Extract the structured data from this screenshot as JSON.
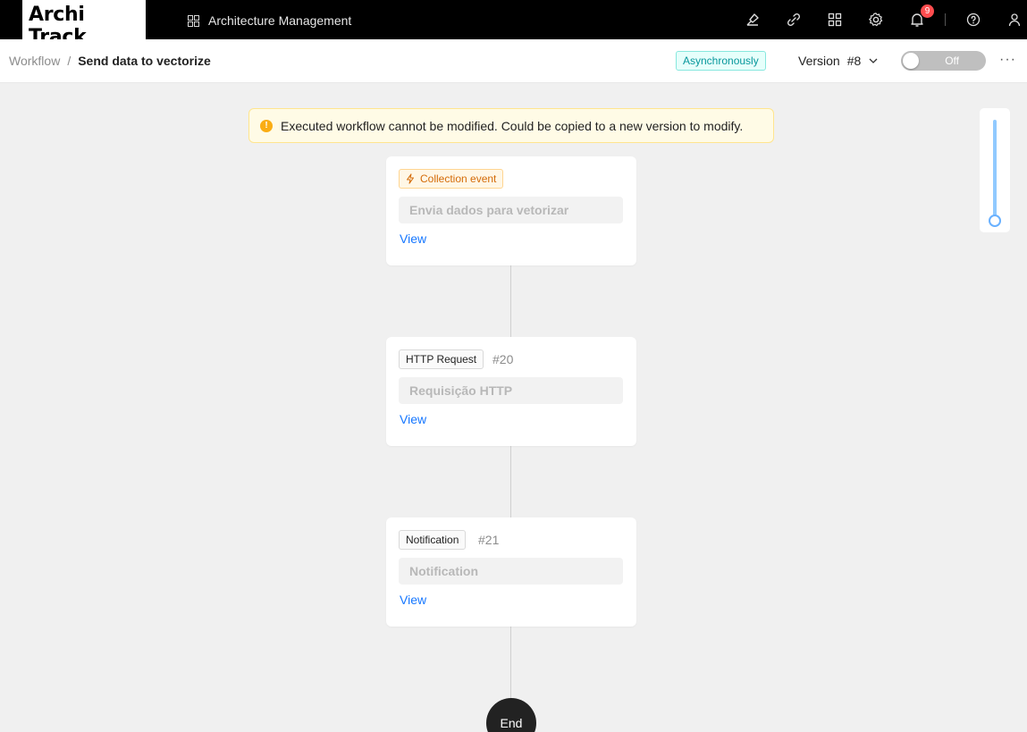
{
  "brand": {
    "logo_text": "Archi Track"
  },
  "topbar": {
    "app_label": "Architecture Management",
    "icons": [
      "brush-icon",
      "link-icon",
      "apps-icon",
      "gear-icon",
      "bell-icon",
      "help-icon",
      "user-icon"
    ],
    "notification_count": "9"
  },
  "header": {
    "breadcrumb_root": "Workflow",
    "breadcrumb_separator": "/",
    "title": "Send data to vectorize",
    "async_tag": "Asynchronously",
    "version_label": "Version",
    "version_value": "#8",
    "toggle_label": "Off",
    "toggle_on": false,
    "more_label": "···"
  },
  "alert": {
    "message": "Executed workflow cannot be modified. Could be copied to a new version to modify.",
    "icon": "warning-icon"
  },
  "nodes": [
    {
      "type_label": "Collection event",
      "id": "",
      "title": "Envia dados para vetorizar",
      "link": "View",
      "kind": "trigger"
    },
    {
      "type_label": "HTTP Request",
      "id": "#20",
      "title": "Requisição HTTP",
      "link": "View",
      "kind": "step"
    },
    {
      "type_label": "Notification",
      "id": "#21",
      "title": "Notification",
      "link": "View",
      "kind": "step"
    }
  ],
  "end_node": {
    "label": "End"
  },
  "zoom": {
    "level_fraction": 0.0
  },
  "colors": {
    "topbar_bg": "#000000",
    "async_tag": "#08979c",
    "trigger_tag": "#d46b08",
    "link": "#1677ff",
    "badge": "#ff4d4f",
    "alert_icon": "#faad14",
    "zoom_track": "#91caff"
  }
}
